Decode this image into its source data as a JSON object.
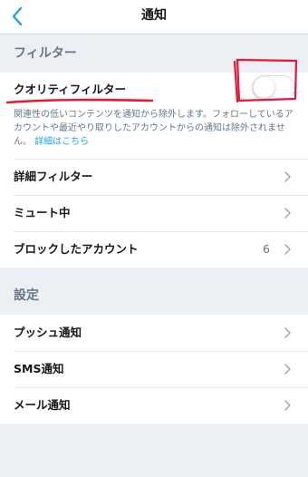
{
  "nav": {
    "title": "通知",
    "back_icon": "chevron-left-icon"
  },
  "filter_section": {
    "header": "フィルター",
    "quality_filter": {
      "label": "クオリティフィルター",
      "toggle_on": false,
      "description": "関連性の低いコンテンツを通知から除外します。フォローしているアカウントや最近やり取りしたアカウントからの通知は除外されません。",
      "link_text": "詳細はこちら"
    },
    "rows": [
      {
        "label": "詳細フィルター",
        "count": ""
      },
      {
        "label": "ミュート中",
        "count": ""
      },
      {
        "label": "ブロックしたアカウント",
        "count": "6"
      }
    ]
  },
  "settings_section": {
    "header": "設定",
    "rows": [
      {
        "label": "プッシュ通知"
      },
      {
        "label": "SMS通知"
      },
      {
        "label": "メール通知"
      }
    ]
  },
  "colors": {
    "accent": "#1da1f2",
    "background": "#eceff3",
    "annotation": "#e8173a"
  }
}
